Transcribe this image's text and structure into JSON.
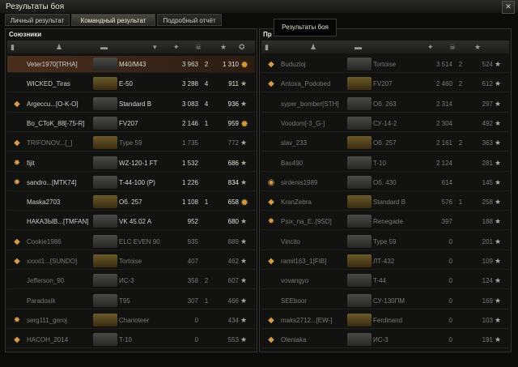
{
  "window": {
    "title": "Результаты боя",
    "close": "✕"
  },
  "tabs": [
    "Личный результат",
    "Командный результат",
    "Подробный отчёт"
  ],
  "tooltip": "Результаты боя",
  "allies": {
    "title": "Союзники",
    "rows": [
      {
        "name": "Veter1970[TRHA]",
        "vehicle": "M40/M43",
        "damage": "3 963",
        "frags": "2",
        "xp": "1 310",
        "medal": true,
        "hl": true,
        "badge": ""
      },
      {
        "name": "WICKED_Tiras",
        "vehicle": "E-50",
        "damage": "3 288",
        "frags": "4",
        "xp": "911",
        "badge": ""
      },
      {
        "name": "Argeccu...[O-K-O]",
        "vehicle": "Standard B",
        "damage": "3 083",
        "frags": "4",
        "xp": "936",
        "badge": "◆"
      },
      {
        "name": "Bo_CToK_88[-75-R]",
        "vehicle": "FV207",
        "damage": "2 146",
        "frags": "1",
        "xp": "959",
        "medal": true,
        "badge": ""
      },
      {
        "name": "TRIFONOV...[_]",
        "vehicle": "Type 59",
        "damage": "1 735",
        "frags": "",
        "xp": "772",
        "dead": true,
        "badge": "◆"
      },
      {
        "name": "fijit",
        "vehicle": "WZ-120-1 FT",
        "damage": "1 532",
        "frags": "",
        "xp": "686",
        "badge": "✸"
      },
      {
        "name": "sandro...[MTK74]",
        "vehicle": "T-44-100 (P)",
        "damage": "1 226",
        "frags": "",
        "xp": "834",
        "badge": "✸"
      },
      {
        "name": "Maska2703",
        "vehicle": "Об. 257",
        "damage": "1 108",
        "frags": "1",
        "xp": "658",
        "medal": true,
        "badge": ""
      },
      {
        "name": "НАКАЗЫВ...[TMFAN]",
        "vehicle": "VK 45.02 A",
        "damage": "952",
        "frags": "",
        "xp": "680",
        "badge": ""
      },
      {
        "name": "Cookie1986",
        "vehicle": "ELC EVEN 90",
        "damage": "935",
        "frags": "",
        "xp": "889",
        "dead": true,
        "badge": "◆"
      },
      {
        "name": "xxxxl1...[SUNDO]",
        "vehicle": "Tortoise",
        "damage": "407",
        "frags": "",
        "xp": "462",
        "dead": true,
        "badge": "◆"
      },
      {
        "name": "Jefferson_90",
        "vehicle": "ИС-3",
        "damage": "358",
        "frags": "2",
        "xp": "607",
        "dead": true,
        "badge": ""
      },
      {
        "name": "Paradoxik",
        "vehicle": "T95",
        "damage": "307",
        "frags": "1",
        "xp": "466",
        "dead": true,
        "badge": ""
      },
      {
        "name": "serg111_geroj",
        "vehicle": "Charioteer",
        "damage": "0",
        "frags": "",
        "xp": "434",
        "dead": true,
        "badge": "✸"
      },
      {
        "name": "HACOH_2014",
        "vehicle": "T-10",
        "damage": "0",
        "frags": "",
        "xp": "553",
        "dead": true,
        "badge": "◆"
      }
    ]
  },
  "enemies": {
    "title": "Пр",
    "rows": [
      {
        "name": "Buduzloj",
        "vehicle": "Tortoise",
        "damage": "3 514",
        "frags": "2",
        "xp": "524",
        "badge": "◆",
        "dead": true
      },
      {
        "name": "Antoxa_Podobed",
        "vehicle": "FV207",
        "damage": "2 460",
        "frags": "2",
        "xp": "612",
        "badge": "◆",
        "dead": true
      },
      {
        "name": "syper_bomber[STH]",
        "vehicle": "Об. 263",
        "damage": "2 314",
        "frags": "",
        "xp": "297",
        "badge": "",
        "dead": true
      },
      {
        "name": "Voodom[-3_G-]",
        "vehicle": "СУ-14-2",
        "damage": "2 304",
        "frags": "",
        "xp": "492",
        "badge": "",
        "dead": true
      },
      {
        "name": "slav_233",
        "vehicle": "Об. 257",
        "damage": "2 161",
        "frags": "2",
        "xp": "363",
        "badge": "",
        "dead": true
      },
      {
        "name": "Bas490",
        "vehicle": "T-10",
        "damage": "2 124",
        "frags": "",
        "xp": "281",
        "badge": "",
        "dead": true
      },
      {
        "name": "sirdenis1989",
        "vehicle": "Об. 430",
        "damage": "614",
        "frags": "",
        "xp": "145",
        "badge": "◉",
        "dead": true
      },
      {
        "name": "KranZebra",
        "vehicle": "Standard B",
        "damage": "576",
        "frags": "1",
        "xp": "258",
        "badge": "◆",
        "dead": true
      },
      {
        "name": "Psix_na_E..[9SD]",
        "vehicle": "Renegade",
        "damage": "397",
        "frags": "",
        "xp": "188",
        "badge": "✸",
        "dead": true
      },
      {
        "name": "Vincito",
        "vehicle": "Type 59",
        "damage": "0",
        "frags": "",
        "xp": "201",
        "badge": "",
        "dead": true
      },
      {
        "name": "ramil163_1[FIB]",
        "vehicle": "ЛТ-432",
        "damage": "0",
        "frags": "",
        "xp": "109",
        "badge": "◆",
        "dead": true
      },
      {
        "name": "vovangyo",
        "vehicle": "T-44",
        "damage": "0",
        "frags": "",
        "xp": "124",
        "badge": "",
        "dead": true
      },
      {
        "name": "SEEboor",
        "vehicle": "СУ-130ПМ",
        "damage": "0",
        "frags": "",
        "xp": "169",
        "badge": "",
        "dead": true
      },
      {
        "name": "maks2712...[EW-]",
        "vehicle": "Ferdinand",
        "damage": "0",
        "frags": "",
        "xp": "103",
        "badge": "◆",
        "dead": true
      },
      {
        "name": "Oleniaka",
        "vehicle": "ИС-3",
        "damage": "0",
        "frags": "",
        "xp": "191",
        "badge": "◆",
        "dead": true
      }
    ]
  }
}
